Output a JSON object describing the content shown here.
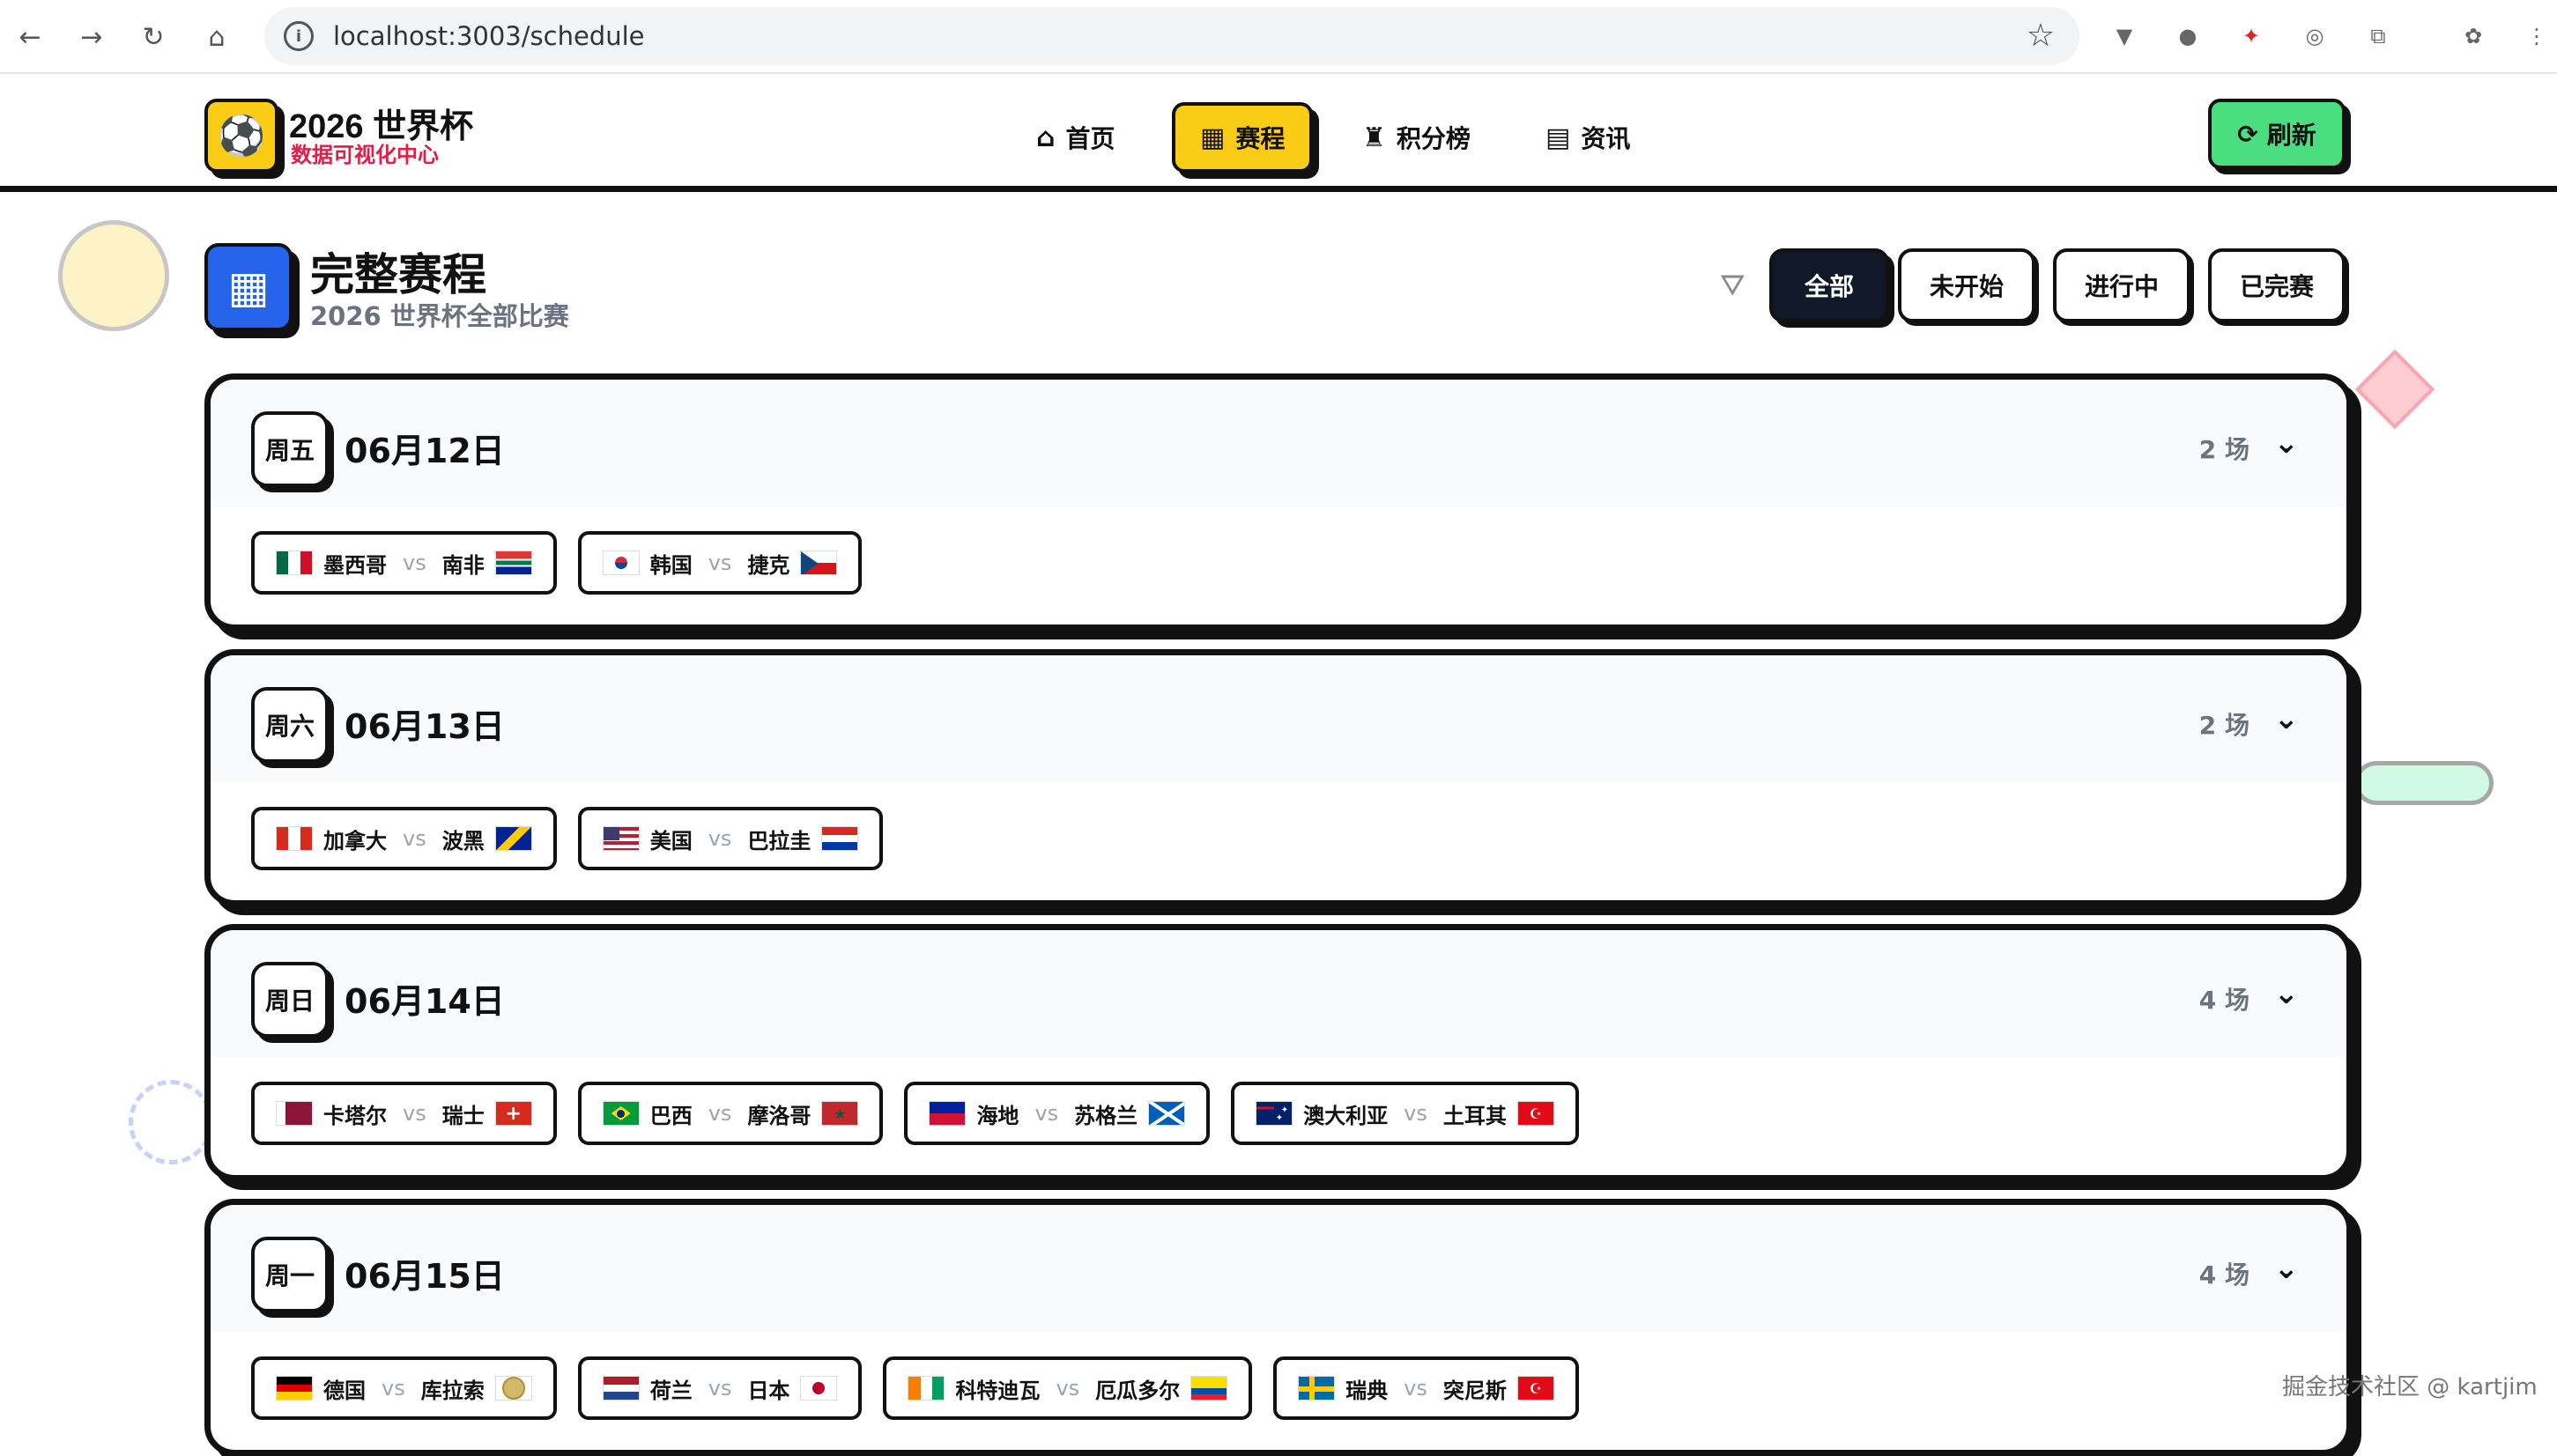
{
  "browser": {
    "url": "localhost:3003/schedule",
    "nav_icons": [
      "back-icon",
      "forward-icon",
      "reload-icon",
      "home-icon"
    ],
    "nav_glyphs": [
      "←",
      "→",
      "↻",
      "⌂"
    ],
    "ext_glyphs": [
      "▼",
      "●",
      "✦",
      "◎",
      "⧉",
      "✿",
      "⋮"
    ],
    "ext_names": [
      "vue-devtools-icon",
      "extension-icon-2",
      "extension-icon-3",
      "extension-icon-4",
      "extensions-puzzle-icon",
      "extension-icon-6",
      "browser-menu-icon"
    ]
  },
  "header": {
    "brand_title": "2026 世界杯",
    "brand_subtitle": "数据可视化中心",
    "logo_glyph": "⚽",
    "nav": [
      {
        "label": "首页",
        "icon": "home-icon",
        "glyph": "⌂"
      },
      {
        "label": "赛程",
        "icon": "calendar-icon",
        "glyph": "▦",
        "active": true
      },
      {
        "label": "积分榜",
        "icon": "trophy-icon",
        "glyph": "♜"
      },
      {
        "label": "资讯",
        "icon": "news-icon",
        "glyph": "▤"
      }
    ],
    "refresh_label": "刷新",
    "refresh_glyph": "⟳"
  },
  "page": {
    "title": "完整赛程",
    "subtitle": "2026 世界杯全部比赛",
    "title_glyph": "▦",
    "filter_glyph": "⛛",
    "filters": [
      "全部",
      "未开始",
      "进行中",
      "已完赛"
    ],
    "active_filter": "全部"
  },
  "days": [
    {
      "weekday": "周五",
      "date": "06月12日",
      "count": "2 场",
      "matches": [
        {
          "home": "墨西哥",
          "away": "南非",
          "home_flag": "mx",
          "away_flag": "za"
        },
        {
          "home": "韩国",
          "away": "捷克",
          "home_flag": "kr",
          "away_flag": "cz"
        }
      ]
    },
    {
      "weekday": "周六",
      "date": "06月13日",
      "count": "2 场",
      "matches": [
        {
          "home": "加拿大",
          "away": "波黑",
          "home_flag": "ca",
          "away_flag": "ba"
        },
        {
          "home": "美国",
          "away": "巴拉圭",
          "home_flag": "us",
          "away_flag": "py"
        }
      ]
    },
    {
      "weekday": "周日",
      "date": "06月14日",
      "count": "4 场",
      "matches": [
        {
          "home": "卡塔尔",
          "away": "瑞士",
          "home_flag": "qa",
          "away_flag": "ch"
        },
        {
          "home": "巴西",
          "away": "摩洛哥",
          "home_flag": "br",
          "away_flag": "ma"
        },
        {
          "home": "海地",
          "away": "苏格兰",
          "home_flag": "ht",
          "away_flag": "sco"
        },
        {
          "home": "澳大利亚",
          "away": "土耳其",
          "home_flag": "au",
          "away_flag": "tr"
        }
      ]
    },
    {
      "weekday": "周一",
      "date": "06月15日",
      "count": "4 场",
      "matches": [
        {
          "home": "德国",
          "away": "库拉索",
          "home_flag": "de",
          "away_flag": "cw"
        },
        {
          "home": "荷兰",
          "away": "日本",
          "home_flag": "nl",
          "away_flag": "jp"
        },
        {
          "home": "科特迪瓦",
          "away": "厄瓜多尔",
          "home_flag": "ci",
          "away_flag": "ec"
        },
        {
          "home": "瑞典",
          "away": "突尼斯",
          "home_flag": "se",
          "away_flag": "tn"
        }
      ]
    }
  ],
  "vs_label": "vs",
  "chevron_glyph": "⌄",
  "watermark": "掘金技术社区 @ kartjim",
  "colors": {
    "accent_yellow": "#facc15",
    "refresh_green": "#4ade80",
    "title_blue": "#2563eb",
    "brand_red": "#e11d48"
  }
}
